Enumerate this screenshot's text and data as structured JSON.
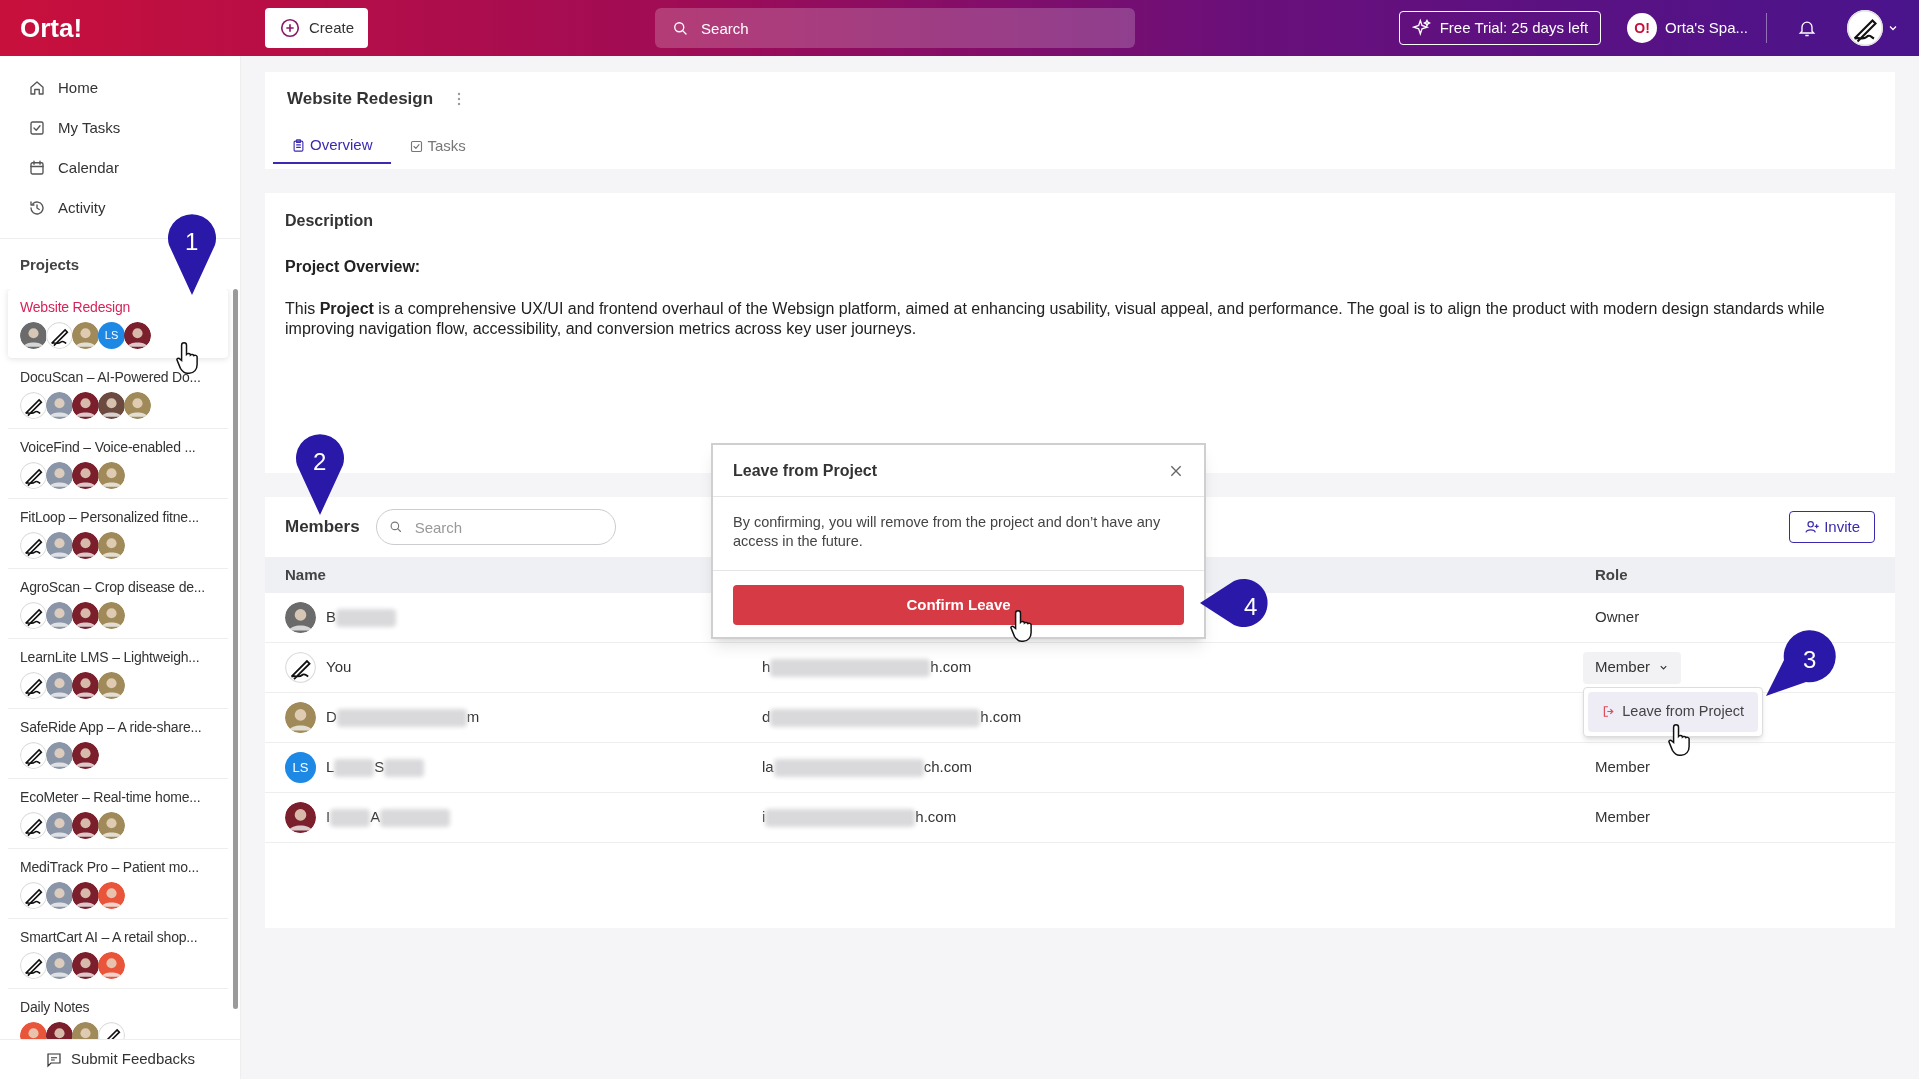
{
  "topbar": {
    "logo": "Orta!",
    "create": "Create",
    "search_placeholder": "Search",
    "trial": "Free Trial: 25 days left",
    "workspace_badge": "O!",
    "workspace": "Orta's Spa..."
  },
  "nav": [
    {
      "label": "Home"
    },
    {
      "label": "My Tasks"
    },
    {
      "label": "Calendar"
    },
    {
      "label": "Activity"
    }
  ],
  "projects_heading": "Projects",
  "projects": [
    {
      "name": "Website Redesign",
      "selected": true,
      "avatars": [
        {
          "kind": "photo",
          "color": "#6b6b6b"
        },
        {
          "kind": "sketch"
        },
        {
          "kind": "photo",
          "color": "#a08a5a"
        },
        {
          "kind": "initials",
          "text": "LS",
          "color": "#1e88e5"
        },
        {
          "kind": "photo",
          "color": "#7a1f2b"
        }
      ]
    },
    {
      "name": "DocuScan – AI-Powered Do...",
      "selected": false,
      "avatars": [
        {
          "kind": "sketch"
        },
        {
          "kind": "photo",
          "color": "#8a96a8"
        },
        {
          "kind": "photo",
          "color": "#7a1f2b"
        },
        {
          "kind": "photo",
          "color": "#6b4a40"
        },
        {
          "kind": "photo",
          "color": "#a08a5a"
        }
      ]
    },
    {
      "name": "VoiceFind – Voice-enabled ...",
      "selected": false,
      "avatars": [
        {
          "kind": "sketch"
        },
        {
          "kind": "photo",
          "color": "#8a96a8"
        },
        {
          "kind": "photo",
          "color": "#7a1f2b"
        },
        {
          "kind": "photo",
          "color": "#a08a5a"
        }
      ]
    },
    {
      "name": "FitLoop – Personalized fitne...",
      "selected": false,
      "avatars": [
        {
          "kind": "sketch"
        },
        {
          "kind": "photo",
          "color": "#8a96a8"
        },
        {
          "kind": "photo",
          "color": "#7a1f2b"
        },
        {
          "kind": "photo",
          "color": "#a08a5a"
        }
      ]
    },
    {
      "name": "AgroScan – Crop disease de...",
      "selected": false,
      "avatars": [
        {
          "kind": "sketch"
        },
        {
          "kind": "photo",
          "color": "#8a96a8"
        },
        {
          "kind": "photo",
          "color": "#7a1f2b"
        },
        {
          "kind": "photo",
          "color": "#a08a5a"
        }
      ]
    },
    {
      "name": "LearnLite LMS – Lightweigh...",
      "selected": false,
      "avatars": [
        {
          "kind": "sketch"
        },
        {
          "kind": "photo",
          "color": "#8a96a8"
        },
        {
          "kind": "photo",
          "color": "#7a1f2b"
        },
        {
          "kind": "photo",
          "color": "#a08a5a"
        }
      ]
    },
    {
      "name": "SafeRide App – A ride-share...",
      "selected": false,
      "avatars": [
        {
          "kind": "sketch"
        },
        {
          "kind": "photo",
          "color": "#8a96a8"
        },
        {
          "kind": "photo",
          "color": "#7a1f2b"
        }
      ]
    },
    {
      "name": "EcoMeter – Real-time home...",
      "selected": false,
      "avatars": [
        {
          "kind": "sketch"
        },
        {
          "kind": "photo",
          "color": "#8a96a8"
        },
        {
          "kind": "photo",
          "color": "#7a1f2b"
        },
        {
          "kind": "photo",
          "color": "#a08a5a"
        }
      ]
    },
    {
      "name": "MediTrack Pro – Patient mo...",
      "selected": false,
      "avatars": [
        {
          "kind": "sketch"
        },
        {
          "kind": "photo",
          "color": "#8a96a8"
        },
        {
          "kind": "photo",
          "color": "#7a1f2b"
        },
        {
          "kind": "photo",
          "color": "#e8553a"
        }
      ]
    },
    {
      "name": "SmartCart AI – A retail shop...",
      "selected": false,
      "avatars": [
        {
          "kind": "sketch"
        },
        {
          "kind": "photo",
          "color": "#8a96a8"
        },
        {
          "kind": "photo",
          "color": "#7a1f2b"
        },
        {
          "kind": "photo",
          "color": "#e8553a"
        }
      ]
    },
    {
      "name": "Daily Notes",
      "selected": false,
      "avatars": [
        {
          "kind": "photo",
          "color": "#e8553a"
        },
        {
          "kind": "photo",
          "color": "#7a1f2b"
        },
        {
          "kind": "photo",
          "color": "#a08a5a"
        },
        {
          "kind": "sketch"
        }
      ]
    }
  ],
  "feedback": "Submit Feedbacks",
  "project": {
    "title": "Website Redesign",
    "tabs": [
      {
        "label": "Overview",
        "selected": true
      },
      {
        "label": "Tasks",
        "selected": false
      }
    ]
  },
  "description": {
    "heading": "Description",
    "subheading": "Project Overview:",
    "text": "This **Project** is a comprehensive UX/UI and frontend overhaul of the Websign platform, aimed at enhancing usability, visual appeal, and performance. The goal is to align the product with modern design standards while improving navigation flow, accessibility, and conversion metrics across key user journeys."
  },
  "members": {
    "heading": "Members",
    "search_placeholder": "Search",
    "invite": "Invite",
    "columns": {
      "name": "Name",
      "role": "Role"
    },
    "rows": [
      {
        "avatar": {
          "kind": "photo",
          "color": "#6b6b6b"
        },
        "name": [
          "B"
        ],
        "name_blurred_end": true,
        "email": [],
        "email_blurred_end": false,
        "role": "Owner",
        "kind": "text"
      },
      {
        "avatar": {
          "kind": "sketch"
        },
        "name": [
          "You"
        ],
        "name_blurred_end": false,
        "email": [
          "h",
          "h.com"
        ],
        "email_blurred_end": false,
        "role": "Member",
        "kind": "dropdown"
      },
      {
        "avatar": {
          "kind": "photo",
          "color": "#a08a5a"
        },
        "name": [
          "D",
          "m"
        ],
        "name_blurred_end": false,
        "email": [
          "d",
          "h.com"
        ],
        "email_blurred_end": false,
        "kind": "menu"
      },
      {
        "avatar": {
          "kind": "initials",
          "text": "LS",
          "color": "#1e88e5"
        },
        "name": [
          "L",
          "S"
        ],
        "name_blurred_end": true,
        "email": [
          "la",
          "ch.com"
        ],
        "email_blurred_end": false,
        "role": "Member",
        "kind": "text"
      },
      {
        "avatar": {
          "kind": "photo",
          "color": "#7a1f2b"
        },
        "name": [
          "I",
          "A"
        ],
        "name_blurred_end": true,
        "email": [
          "i",
          "h.com"
        ],
        "email_blurred_end": false,
        "role": "Member",
        "kind": "text"
      }
    ],
    "menu_item": "Leave from Project"
  },
  "dialog": {
    "title": "Leave from Project",
    "body": "By confirming, you will remove from the project and don’t have any access in the future.",
    "confirm": "Confirm Leave"
  },
  "callouts": [
    "1",
    "2",
    "3",
    "4"
  ]
}
